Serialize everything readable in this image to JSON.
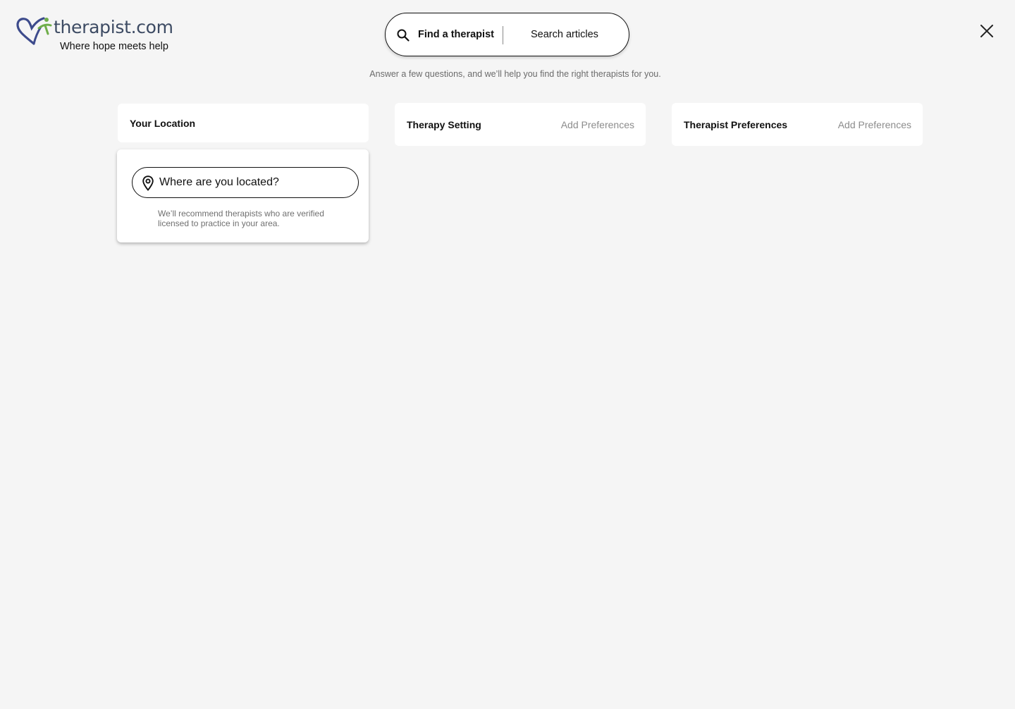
{
  "header": {
    "logo": {
      "wordmark": "therapist.com",
      "tagline": "Where hope meets help",
      "colors": {
        "heart_blue": "#3d4b8c",
        "figure_green": "#6fae4a",
        "wordmark": "#3d4b63"
      }
    },
    "search": {
      "icon": "search-icon",
      "tab_find": "Find a therapist",
      "tab_articles": "Search articles"
    },
    "close_icon": "close-icon"
  },
  "subtitle": "Answer a few questions, and we’ll help you find the right therapists for you.",
  "steps": [
    {
      "title": "Your Location",
      "action": ""
    },
    {
      "title": "Therapy Setting",
      "action": "Add Preferences"
    },
    {
      "title": "Therapist Preferences",
      "action": "Add Preferences"
    }
  ],
  "location_panel": {
    "icon": "location-pin-icon",
    "placeholder": "Where are you located?",
    "help_text": "We’ll recommend therapists who are verified licensed to practice in your area."
  },
  "colors": {
    "background": "#f5f5f5",
    "card": "#ffffff",
    "muted_text": "#8c8c8c",
    "border": "#111111"
  }
}
